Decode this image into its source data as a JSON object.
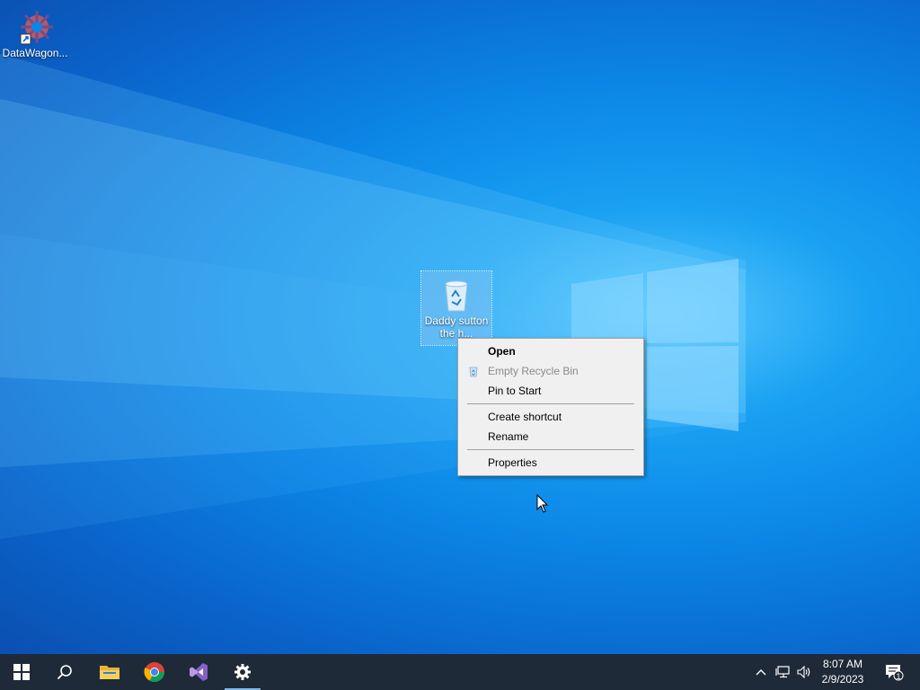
{
  "desktop": {
    "icons": [
      {
        "label": "DataWagon...",
        "icon": "gear-shortcut-icon"
      },
      {
        "label": "Daddy sutton the h...",
        "icon": "recycle-bin-icon"
      }
    ]
  },
  "context_menu": {
    "items": [
      {
        "label": "Open",
        "bold": true
      },
      {
        "label": "Empty Recycle Bin",
        "disabled": true,
        "icon": "recycle-bin-icon"
      },
      {
        "label": "Pin to Start"
      },
      {
        "separator": true
      },
      {
        "label": "Create shortcut"
      },
      {
        "label": "Rename"
      },
      {
        "separator": true
      },
      {
        "label": "Properties"
      }
    ]
  },
  "taskbar": {
    "apps": [
      {
        "name": "start-button",
        "icon": "windows-icon"
      },
      {
        "name": "search-button",
        "icon": "search-icon"
      },
      {
        "name": "file-explorer",
        "icon": "folder-icon"
      },
      {
        "name": "chrome",
        "icon": "chrome-icon"
      },
      {
        "name": "visual-studio",
        "icon": "visual-studio-icon"
      },
      {
        "name": "settings",
        "icon": "gear-icon",
        "active": true
      }
    ],
    "tray": {
      "time": "8:07 AM",
      "date": "2/9/2023",
      "notification_count": "1"
    }
  },
  "colors": {
    "taskbar": "#1f2a38",
    "desktop_accent": "#0b86e6",
    "menu_bg": "#f0f0f0"
  }
}
